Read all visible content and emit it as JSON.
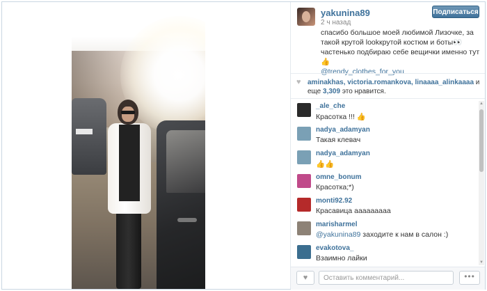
{
  "post": {
    "username": "yakunina89",
    "follow_label": "Подписаться",
    "time_ago": "2 ч назад",
    "caption": "спасибо большое моей любимой Лизочке, за такой крутой lookкрутой костюм и боты👀частенько подбираю себе вещички именно тут 👍",
    "caption_tag": "@trendy_clothes_for_you"
  },
  "likes": {
    "users": "aminakhas, victoria.romankova, linaaaa_alinkaaaa",
    "suffix_1": " и еще ",
    "count": "3,309",
    "suffix_2": " это нравится."
  },
  "comments": [
    {
      "user": "_ale_che",
      "text": "Красотка !!! 👍",
      "avatar_color": "#2a2a2a"
    },
    {
      "user": "nadya_adamyan",
      "text": "Такая клевач",
      "avatar_color": "#7aa0b5"
    },
    {
      "user": "nadya_adamyan",
      "text": "👍👍",
      "avatar_color": "#7aa0b5"
    },
    {
      "user": "omne_bonum",
      "text": "Красотка;*)",
      "avatar_color": "#c04a8a"
    },
    {
      "user": "monti92.92",
      "text": "Красавица ааааааааа",
      "avatar_color": "#b52a2a"
    },
    {
      "user": "marisharmel",
      "text_mention": "@yakunina89",
      "text": " заходите к нам в салон :)",
      "avatar_color": "#8d8276"
    },
    {
      "user": "evakotova_",
      "text": "Взаимно лайки",
      "avatar_color": "#3b6e8f"
    }
  ],
  "footer": {
    "comment_placeholder": "Оставить комментарий...",
    "more_label": "•••"
  },
  "icons": {
    "heart": "heart-icon",
    "more": "more-icon"
  },
  "colors": {
    "link": "#3f729b",
    "follow_button": "#3f729b"
  }
}
